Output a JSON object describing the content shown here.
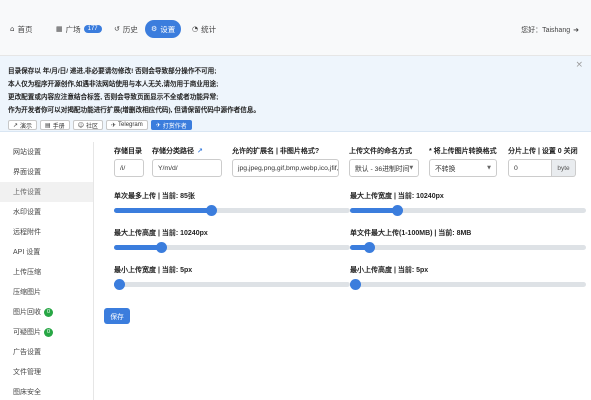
{
  "nav": {
    "items": [
      {
        "icon": "home-icon",
        "glyph": "⌂",
        "label": "首页",
        "active": false
      },
      {
        "icon": "grid-icon",
        "glyph": "▦",
        "label": "广场",
        "badge": "177",
        "active": false
      },
      {
        "icon": "history-icon",
        "glyph": "↺",
        "label": "历史",
        "active": false
      },
      {
        "icon": "gear-icon",
        "glyph": "⚙",
        "label": "设置",
        "active": true
      },
      {
        "icon": "pie-chart-icon",
        "glyph": "◔",
        "label": "统计",
        "active": false
      }
    ],
    "user_greeting": "您好：Taishang",
    "logout_glyph": "➜"
  },
  "notice": {
    "close_glyph": "×",
    "lines": [
      "目录保存以 年/月/日/ 递进,非必要请勿修改! 否则会导致部分操作不可用;",
      "本人仅为程序开源创作,如遇非法网站使用与本人无关,请勿用于商业用途;",
      "更改配置或内容应注意结合标签, 否则会导致页面显示不全或者功能异常;",
      "作为开发者你可以对揭配功能进行扩展(增删改相应代码), 但请保留代码中源作者信息。"
    ],
    "links": [
      {
        "icon": "external-link-icon",
        "glyph": "↗",
        "label": "演示"
      },
      {
        "icon": "book-icon",
        "glyph": "▤",
        "label": "手册"
      },
      {
        "icon": "community-icon",
        "glyph": "☺",
        "label": "社区"
      },
      {
        "icon": "telegram-icon",
        "glyph": "✈",
        "label": "Telegram"
      },
      {
        "icon": "telegram-icon",
        "glyph": "✈",
        "label": "打赏作者",
        "primary": true
      }
    ]
  },
  "sidebar": {
    "items": [
      {
        "label": "网站设置"
      },
      {
        "label": "界面设置"
      },
      {
        "label": "上传设置",
        "active": true
      },
      {
        "label": "水印设置"
      },
      {
        "label": "远程附件"
      },
      {
        "label": "API 设置"
      },
      {
        "label": "上传压缩"
      },
      {
        "label": "压缩图片"
      },
      {
        "label": "图片回收",
        "badge": "0"
      },
      {
        "label": "可疑图片",
        "badge": "0"
      },
      {
        "label": "广告设置"
      },
      {
        "label": "文件管理"
      },
      {
        "label": "图床安全"
      }
    ]
  },
  "form": {
    "storage_dir": {
      "label": "存储目录",
      "value": "/i/"
    },
    "storage_path": {
      "label": "存储分类路径",
      "value": "Y/m/d/"
    },
    "extensions": {
      "label": "允许的扩展名 | 非图片格式?",
      "value": "jpg,jpeg,png,gif,bmp,webp,ico,jfif,"
    },
    "naming": {
      "label": "上传文件的命名方式",
      "value": "默认 - 36进制时间"
    },
    "convert": {
      "label": "* 将上传图片转换格式",
      "value": "不转换"
    },
    "chunk": {
      "label": "分片上传 | 设置 0 关闭",
      "value": "0",
      "unit": "byte"
    },
    "sliders": [
      {
        "label": "单次最多上传 | 当前: 85张",
        "level": 0.41
      },
      {
        "label": "最大上传宽度 | 当前: 10240px",
        "level": 0.2
      },
      {
        "label": "最大上传高度 | 当前: 10240px",
        "level": 0.2
      },
      {
        "label": "单文件最大上传(1-100MB) | 当前: 8MB",
        "level": 0.08
      },
      {
        "label": "最小上传宽度 | 当前: 5px",
        "level": 0.02
      },
      {
        "label": "最小上传高度 | 当前: 5px",
        "level": 0.02
      }
    ],
    "save_label": "保存"
  }
}
